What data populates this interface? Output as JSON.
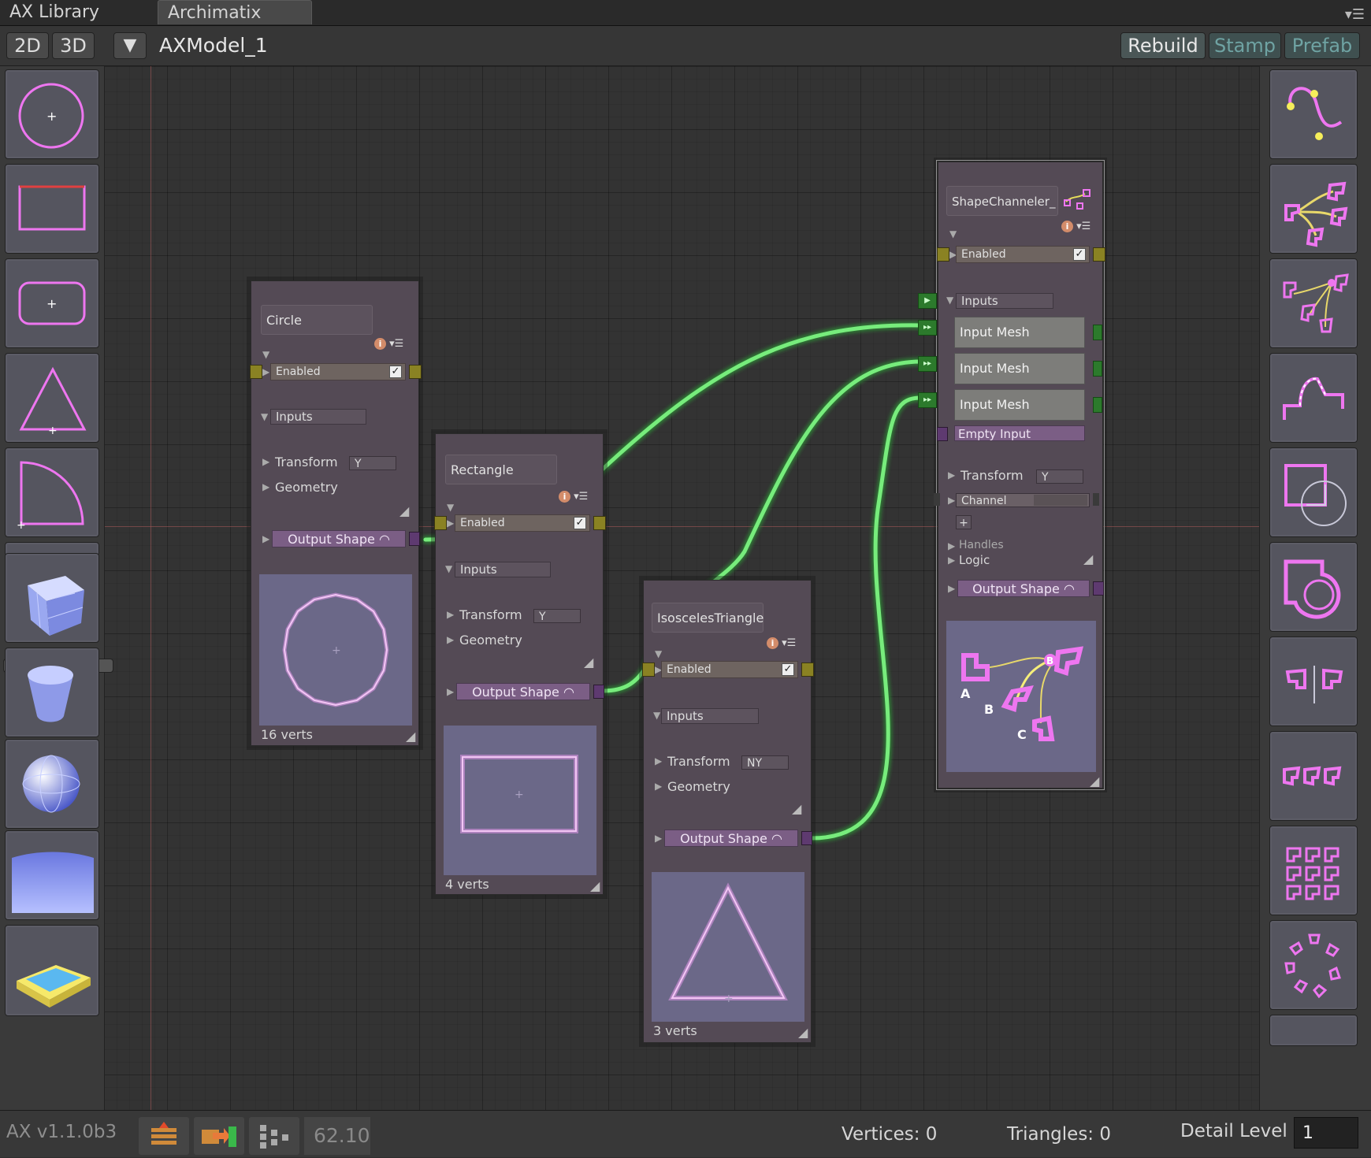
{
  "tabs": [
    {
      "label": "AX Library"
    },
    {
      "label": "Archimatix"
    }
  ],
  "toolbar": {
    "btn_2d": "2D",
    "btn_3d": "3D",
    "dropdown": "▼",
    "model_name": "AXModel_1",
    "rebuild": "Rebuild",
    "stamp": "Stamp",
    "prefab": "Prefab"
  },
  "left_panel": {
    "divider": "="
  },
  "colors": {
    "wire": "#73e879",
    "shape": "#ee76f0",
    "port_yellow": "#8a8223",
    "port_purple": "#5e3a70",
    "node_bg": "#544a55"
  },
  "nodes": {
    "circle": {
      "title": "Circle",
      "enabled": "Enabled",
      "inputs": "Inputs",
      "transform": "Transform",
      "transform_val": "Y",
      "geometry": "Geometry",
      "output": "Output Shape",
      "verts": "16 verts"
    },
    "rectangle": {
      "title": "Rectangle",
      "enabled": "Enabled",
      "inputs": "Inputs",
      "transform": "Transform",
      "transform_val": "Y",
      "geometry": "Geometry",
      "output": "Output Shape",
      "verts": "4 verts"
    },
    "triangle": {
      "title": "IsoscelesTriangle",
      "enabled": "Enabled",
      "inputs": "Inputs",
      "transform": "Transform",
      "transform_val": "NY",
      "geometry": "Geometry",
      "output": "Output Shape",
      "verts": "3 verts"
    },
    "channeler": {
      "title": "ShapeChanneler_",
      "enabled": "Enabled",
      "inputs": "Inputs",
      "input_meshes": [
        "Input Mesh",
        "Input Mesh",
        "Input Mesh"
      ],
      "empty_input": "Empty Input",
      "transform": "Transform",
      "transform_val": "Y",
      "channel": "Channel",
      "channel_val": "",
      "add": "+",
      "handles": "Handles",
      "logic": "Logic",
      "output": "Output Shape",
      "preview_labels": [
        "A",
        "B",
        "C",
        "B"
      ]
    }
  },
  "status": {
    "version": "AX v1.1.0b3",
    "zoom": "62.10",
    "vertices": "Vertices: 0",
    "triangles": "Triangles: 0",
    "detail_label": "Detail Level",
    "detail_value": "1"
  }
}
